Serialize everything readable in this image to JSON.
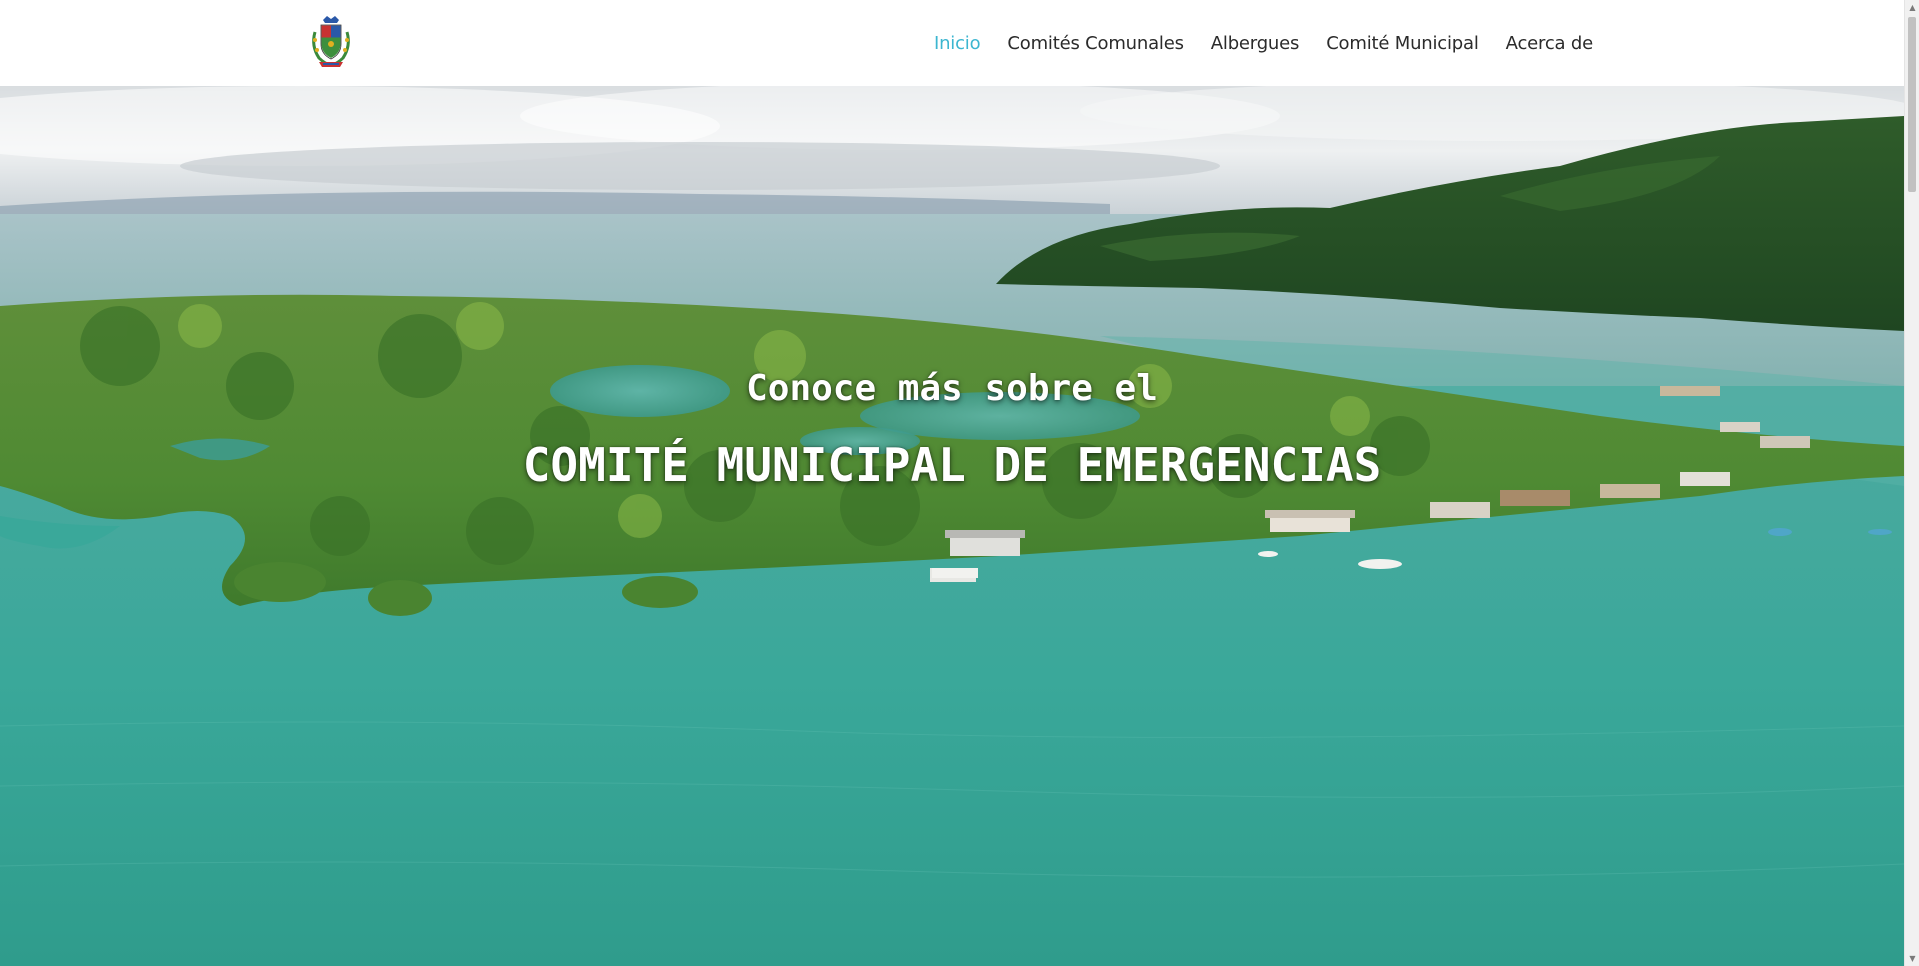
{
  "nav": {
    "items": [
      {
        "label": "Inicio",
        "active": true
      },
      {
        "label": "Comités Comunales",
        "active": false
      },
      {
        "label": "Albergues",
        "active": false
      },
      {
        "label": "Comité Municipal",
        "active": false
      },
      {
        "label": "Acerca de",
        "active": false
      }
    ]
  },
  "colors": {
    "nav_active": "#3cb6d0",
    "nav_text": "#2b2b2b",
    "hero_text": "#ffffff",
    "water": "#3aa89a"
  },
  "logo": {
    "icon": "municipal-coat-of-arms-logo"
  },
  "hero": {
    "subtitle": "Conoce más sobre el",
    "title": "COMITÉ MUNICIPAL DE EMERGENCIAS",
    "background": "aerial-photo-mangrove-peninsula"
  },
  "scrollbar": {
    "up_icon": "scroll-up-arrow-icon",
    "down_icon": "scroll-down-arrow-icon"
  }
}
